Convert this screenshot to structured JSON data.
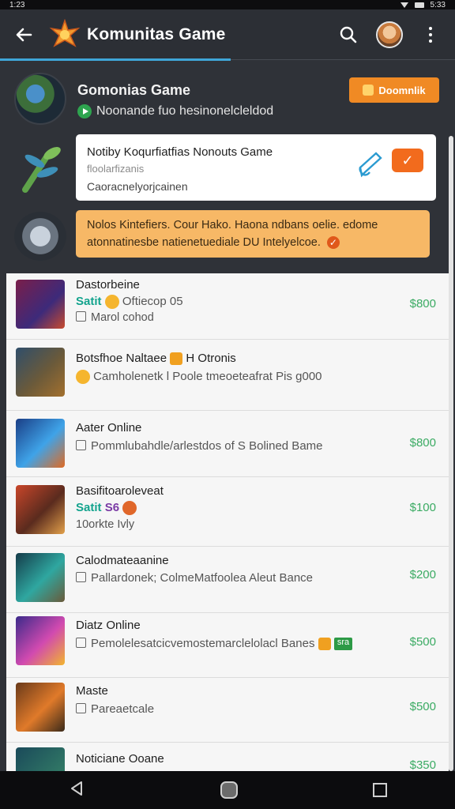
{
  "status_bar": {
    "left": "1:23",
    "right": "5:33"
  },
  "app_bar": {
    "title": "Komunitas Game"
  },
  "group": {
    "title": "Gomonias Game",
    "subtitle": "Noonande fuo hesinonelcleldod",
    "follow_label": "Doomnlik"
  },
  "notification": {
    "title": "Notiby Koqurfiatfias Nonouts Game",
    "subtitle": "floolarfizanis",
    "body": "Caoracnelyorjcainen",
    "action_label": "✓"
  },
  "warning": {
    "line1": "Nolos Kintefiers. Cour Hako. Haona ndbans oelie. edome",
    "line2": "atonnatinesbe natienetuediale DU Intelyelcoe."
  },
  "games": [
    {
      "title": "Dastorbeine",
      "line2_prefix": "Satit",
      "line2_text": "Oftiecop  05",
      "line3": "Marol cohod",
      "price": "$800"
    },
    {
      "title": "Botsfhoe Naltaee",
      "title_suffix": "H Otronis",
      "line2_text": "Camholenetk  l Poole tmeoeteafrat Pis g000",
      "line3": "",
      "price": ""
    },
    {
      "title": "Aater Online",
      "line2_text": "Pommlubahdle/arlestdos of S Bolined Bame",
      "line3": "",
      "price": "$800"
    },
    {
      "title": "Basifitoaroleveat",
      "line2_prefix": "Satit",
      "line2_text": "S6",
      "line3": "10orkte Ivly",
      "price": "$100"
    },
    {
      "title": "Calodmateaanine",
      "line2_text": "Pallardonek;  ColmeMatfoolea Aleut Bance",
      "line3": "",
      "price": "$200"
    },
    {
      "title": "Diatz Online",
      "line2_text": "Pemolelesatcicvemostemarclelolacl Banes",
      "tag": "sra",
      "line3": "",
      "price": "$500"
    },
    {
      "title": "Maste",
      "line2_text": "Pareaetcale",
      "line3": "",
      "price": "$500"
    },
    {
      "title": "Noticiane Ooane",
      "line2_text": "",
      "line3": "",
      "price": "$350"
    }
  ],
  "colors": {
    "accent": "#3fa6d8",
    "orange": "#f08a24",
    "price_green": "#3bab63",
    "teal": "#12a38d"
  }
}
